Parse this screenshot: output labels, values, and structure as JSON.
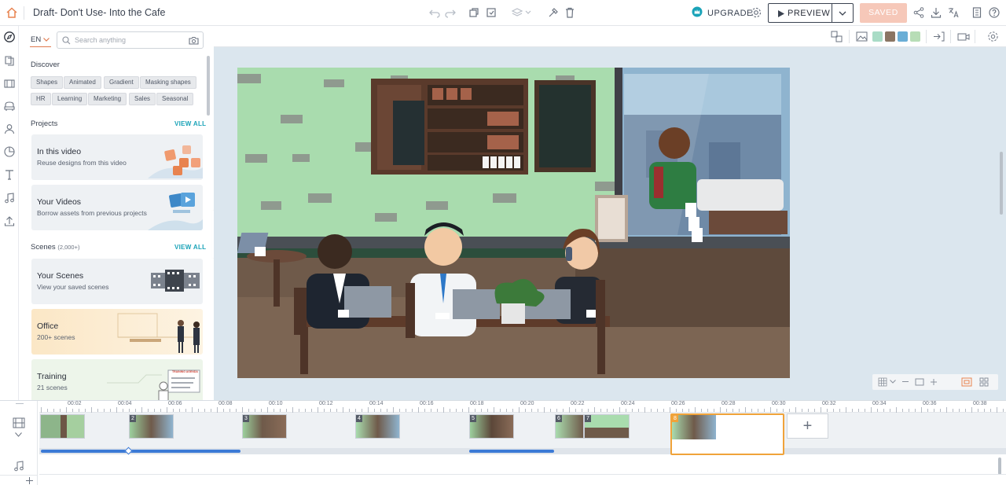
{
  "header": {
    "title": "Draft- Don't Use- Into the Cafe",
    "upgrade_label": "UPGRADE",
    "preview_label": "PREVIEW",
    "saved_label": "SAVED"
  },
  "canvas_toolbar": {
    "swatches": [
      "#a9dcc6",
      "#8a7563",
      "#6aaed6",
      "#b7ddb6"
    ]
  },
  "panel": {
    "language": "EN",
    "search_placeholder": "Search anything",
    "discover_title": "Discover",
    "tags": [
      "Shapes",
      "Animated",
      "Gradient",
      "Masking shapes",
      "HR",
      "Learning",
      "Marketing",
      "Sales",
      "Seasonal"
    ],
    "projects_title": "Projects",
    "view_all": "VIEW ALL",
    "projects": [
      {
        "title": "In this video",
        "subtitle": "Reuse designs from this video"
      },
      {
        "title": "Your Videos",
        "subtitle": "Borrow assets from previous projects"
      }
    ],
    "scenes_title": "Scenes",
    "scenes_count": "(2,000+)",
    "scenes": [
      {
        "title": "Your Scenes",
        "subtitle": "View your saved scenes"
      },
      {
        "title": "Office",
        "subtitle": "200+ scenes"
      },
      {
        "title": "Training",
        "subtitle": "21 scenes"
      }
    ]
  },
  "scene_text": {
    "sign_text": "TRAINING AGENDA"
  },
  "timeline": {
    "ticks": [
      "00:02",
      "00:04",
      "00:06",
      "00:08",
      "00:10",
      "00:12",
      "00:14",
      "00:16",
      "00:18",
      "00:20",
      "00:22",
      "00:24",
      "00:26",
      "00:28",
      "00:30",
      "00:32",
      "00:34",
      "00:36",
      "00:38"
    ],
    "scene_numbers": [
      "2",
      "3",
      "4",
      "5",
      "6",
      "7",
      "8"
    ],
    "add_label": "+"
  }
}
